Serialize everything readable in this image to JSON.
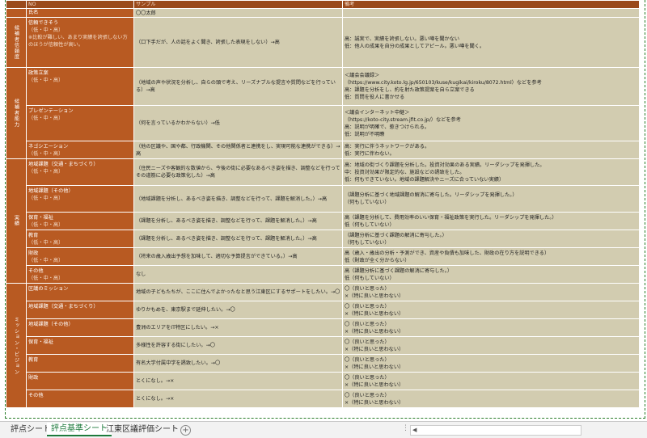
{
  "header": {
    "no": "NO",
    "sample": "サンプル",
    "remarks": "備考"
  },
  "name_row": {
    "label": "氏名",
    "value": "〇〇太郎"
  },
  "categories": {
    "candidate": "候補者信頼度",
    "ability": "候補者能力",
    "achievement": "実績",
    "mission": "ミッション・ビジョン"
  },
  "rows": [
    {
      "item": "信頼できそう",
      "sub1": "（低・中・高）",
      "sub2": "※比較が難しい、あまり実績を誇張しない方のほうが信頼性が高い。",
      "sample": "（口下手だが、人の話をよく聞き、誇張した表現をしない）→高",
      "remarks": [
        "高：誠実で、実績を誇張しない。悪い噂を聞かない",
        "低：他人の成果を自分の成果としてアピール。悪い噂を聞く。"
      ]
    },
    {
      "item": "政策立案",
      "sub1": "（低・中・高）",
      "sample": "（地域の声や状況を分析し、自らの頭で考え、リーズナブルな提言や質問などを行っている）→高",
      "remarks": [
        "＜議会会議録＞",
        "（https://www.city.koto.lg.jp/650103/kuse/kugikai/kiroku/8072.html）などを参考",
        "高：課題を分析をし、約を射た政策提案を自ら立案できる",
        "低：質問を役人に書かせる"
      ]
    },
    {
      "item": "プレゼンテーション",
      "sub1": "（低・中・高）",
      "sample": "（何を言っているかわからない）→低",
      "remarks": [
        "＜議会インターネット中継＞",
        "（https://koto-city.stream.jfit.co.jp/）などを参考",
        "高：説明が明確で、惹きつけられる。",
        "低：説明が不明瞭"
      ]
    },
    {
      "item": "ネゴシエーション",
      "sub1": "（低・中・高）",
      "sample": "（他の区議や、国や都、行政機関、その他関係者と連携をし、実現可能な連携ができる）→高",
      "remarks": [
        "高：実行に伴うネットワークがある。",
        "低：実行に伴わない。"
      ]
    },
    {
      "item": "地域課題（交通・まちづくり）",
      "sub1": "（低・中・高）",
      "sample": "（住民ニーズや客観的な数値から、今後の街に必要なあるべき姿を描き、調整などを行ってその道筋に必要な政策化した）→高",
      "remarks": [
        "高：地域の街づくり課題を分析した。投資対効果のある実績。リーダシップを発揮した。",
        "中：投資対効果が限定的な、施設などの誘致をした。",
        "低：何もできていない。地域の課題解決やニーズに合っていない実績）"
      ]
    },
    {
      "item": "地域課題（その他）",
      "sub1": "（低・中・高）",
      "sample": "（地域課題を分析し、あるべき姿を描き、調整などを行って、課題を解消した。）→高",
      "remarks": [
        "（課題分析に基づく地域課題の解消に寄与した。リーダシップを発揮した。）",
        "（何もしていない）"
      ]
    },
    {
      "item": "保育・福祉",
      "sub1": "（低・中・高）",
      "sample": "（課題を分析し、あるべき姿を描き、調整などを行って、課題を解消した。）→高",
      "remarks": [
        "高（課題を分析して、費用効率のいい保育・福祉政策を実行した。リーダシップを発揮した。）",
        "低（何もしていない）"
      ]
    },
    {
      "item": "教育",
      "sub1": "（低・中・高）",
      "sample": "（課題を分析し、あるべき姿を描き、調整などを行って、課題を解消した。）→高",
      "remarks": [
        "（課題分析に基づく課題の解消に寄与した。）",
        "（何もしていない）"
      ]
    },
    {
      "item": "財政",
      "sub1": "（低・中・高）",
      "sample": "（将来の歳入歳出予想を加味して、適切な予算提言ができている。）→高",
      "remarks": [
        "高（歳入・歳出の分析・予測ができ、資産や負債も加味した、財政の在り方を説明できる）",
        "低（財政が全く分からない）"
      ]
    },
    {
      "item": "その他",
      "sub1": "（低・中・高）",
      "sample": "なし",
      "remarks": [
        "高（課題分析に基づく課題の解消に寄与した。）",
        "低（何もしていない）"
      ]
    },
    {
      "item": "区議のミッション",
      "sample": "地域の子どもたちが、ここに住んでよかったなと思う江東区にするサポートをしたい。→〇",
      "remarks": [
        "〇（良いと思った）",
        "×（特に良いと思わない）"
      ]
    },
    {
      "item": "地域課題（交通・まちづくり）",
      "sample": "ゆりかもめを、東京駅まで延伸したい。→〇",
      "remarks": [
        "〇（良いと思った）",
        "×（特に良いと思わない）"
      ]
    },
    {
      "item": "地域課題（その他）",
      "sample": "豊洲のエリアをIT特区にしたい。→×",
      "remarks": [
        "〇（良いと思った）",
        "×（特に良いと思わない）"
      ]
    },
    {
      "item": "保育・福祉",
      "sample": "多様性を許容する街にしたい。→〇",
      "remarks": [
        "〇（良いと思った）",
        "×（特に良いと思わない）"
      ]
    },
    {
      "item": "教育",
      "sample": "有名大学付属中学を誘致したい。→〇",
      "remarks": [
        "〇（良いと思った）",
        "×（特に良いと思わない）"
      ]
    },
    {
      "item": "財政",
      "sample": "とくになし。→×",
      "remarks": [
        "〇（良いと思った）",
        "×（特に良いと思わない）"
      ]
    },
    {
      "item": "その他",
      "sample": "とくになし。→×",
      "remarks": [
        "〇（良いと思った）",
        "×（特に良いと思わない）"
      ]
    }
  ],
  "tabs": [
    "評点シート",
    "評点基準シート",
    "江東区議評価シート"
  ],
  "add_sheet": "+",
  "more": "⋮",
  "scroll_left": "◀"
}
